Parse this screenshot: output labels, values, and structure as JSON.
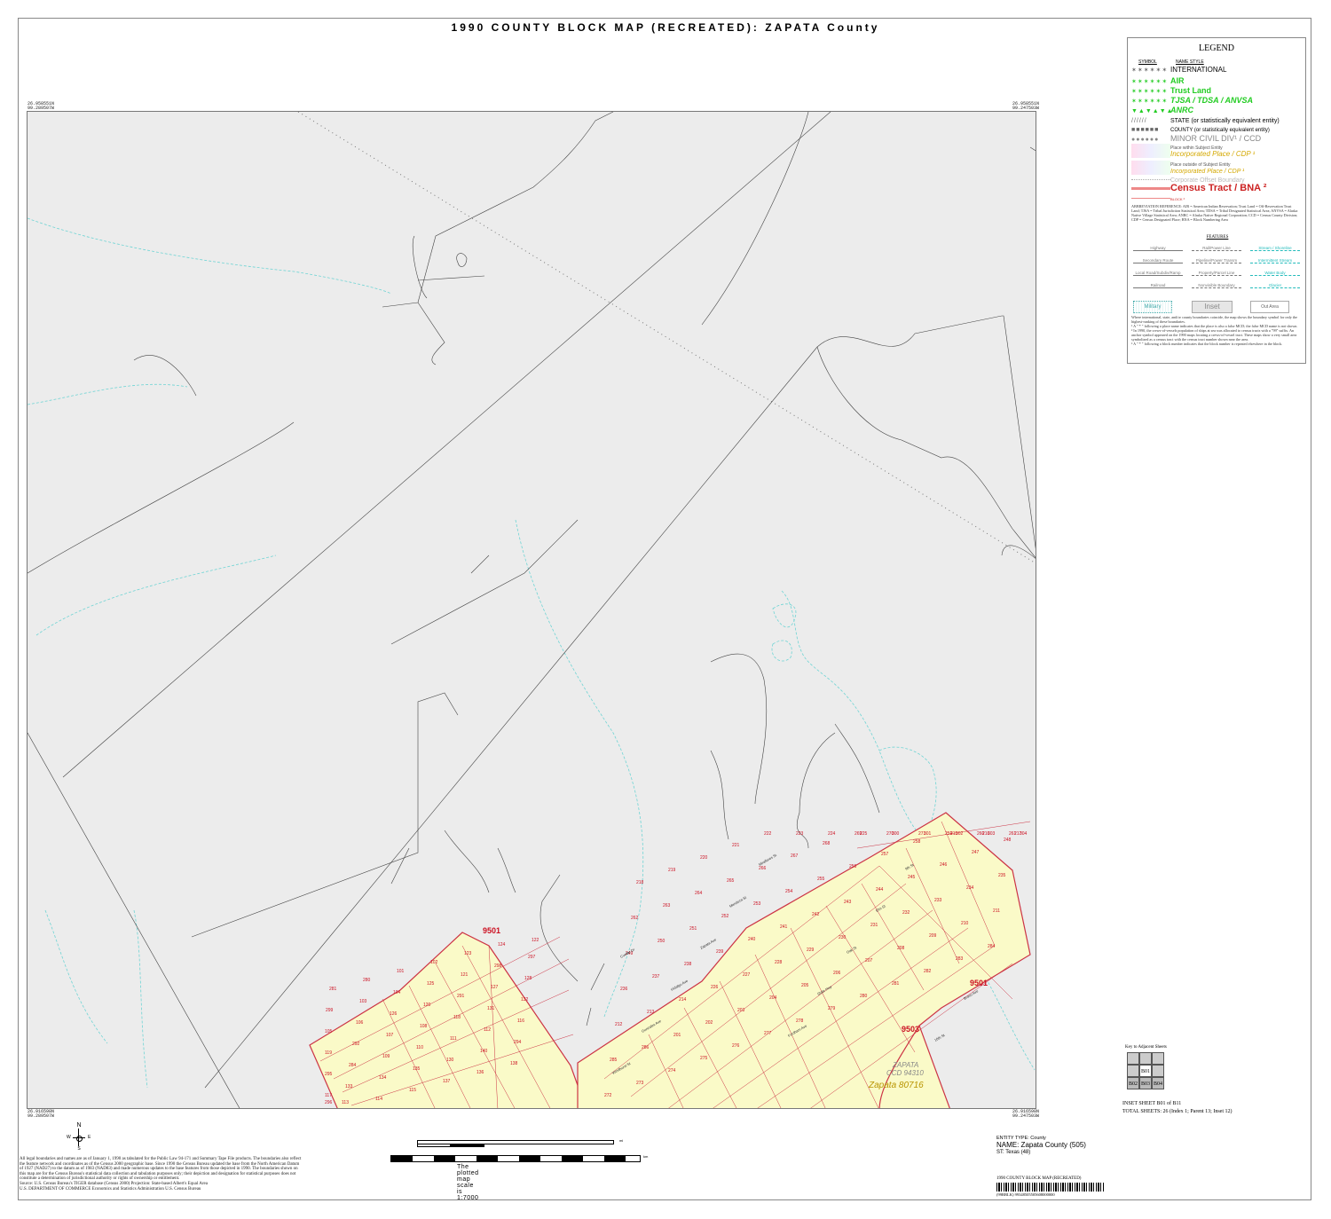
{
  "title": "1990 COUNTY BLOCK MAP (RECREATED): ZAPATA County",
  "corners": {
    "top_left": [
      "26.958551N",
      "99.289507W"
    ],
    "top_right": [
      "26.958551N",
      "99.247503W"
    ],
    "bottom_left": [
      "26.916598N",
      "99.289507W"
    ],
    "bottom_right": [
      "26.916598N",
      "99.247503W"
    ]
  },
  "legend": {
    "title": "LEGEND",
    "symbol_header": "SYMBOL",
    "name_header": "NAME STYLE",
    "items": [
      {
        "symbol": "✶✶✶✶✶✶",
        "label": "INTERNATIONAL",
        "color": "#000000"
      },
      {
        "symbol": "✶✶✶✶✶✶",
        "label": "AIR",
        "color": "#22cc22"
      },
      {
        "symbol": "✶✶✶✶✶✶",
        "label": "Trust Land",
        "color": "#22cc22"
      },
      {
        "symbol": "✶✶✶✶✶✶",
        "label": "TJSA / TDSA / ANVSA",
        "color": "#22cc22"
      },
      {
        "symbol": "▼▲▼▲▼▲",
        "label": "ANRC",
        "color": "#22cc22"
      },
      {
        "symbol": "//////",
        "label": "STATE (or statistically equivalent entity)",
        "color": "#000000"
      },
      {
        "symbol": "■■■■■■",
        "label": "COUNTY (or statistically equivalent entity)",
        "color": "#000000"
      },
      {
        "symbol": "●●●●●●",
        "label": "MINOR CIVIL DIV¹ / CCD",
        "color": "#888888"
      },
      {
        "symbol": "",
        "label": "Place within Subject Entity",
        "color": "#555555"
      },
      {
        "symbol": "",
        "label": "Incorporated Place / CDP ¹",
        "color": "#d4a800"
      },
      {
        "symbol": "",
        "label": "Place outside of Subject Entity",
        "color": "#555555"
      },
      {
        "symbol": "",
        "label": "Incorporated Place / CDP ¹",
        "color": "#d4a800"
      },
      {
        "symbol": "",
        "label": "Corporate Offset Boundary",
        "color": "#bbbbbb"
      },
      {
        "symbol": "",
        "label": "Census Tract / BNA ²",
        "color": "#cc2222"
      },
      {
        "symbol": "",
        "label": "BLOCK ³",
        "color": "#cc2222"
      }
    ],
    "abbreviation_reference": "ABBREVIATION REFERENCE: AIR = American Indian Reservation; Trust Land = Off-Reservation Trust Land; TJSA = Tribal Jurisdiction Statistical Area; TDSA = Tribal Designated Statistical Area; ANVSA = Alaska Native Village Statistical Area; ANRC = Alaska Native Regional Corporation; CCD = Census County Division; CDP = Census Designated Place; BNA = Block Numbering Area",
    "features_title": "FEATURES",
    "features": [
      "Highway",
      "Rail/Power Line",
      "Stream / Shoreline",
      "Secondary Route",
      "Pipeline/Power Transm",
      "Intermittent Stream",
      "Local Road/Subdiv/Ramp",
      "Property/Parcel Line",
      "Water Body",
      "Railroad",
      "Nonvisible Boundary",
      "Glacier"
    ],
    "box_labels": [
      "Military",
      "Inset",
      "Out Area"
    ],
    "notes": [
      "Where international, state, and/or county boundaries coincide, the map shows the boundary symbol for only the highest-ranking of these boundaries.",
      "¹ A \" * \" following a place name indicates that the place is also a false MCD; the false MCD name is not shown.",
      "² In 1990, the crews-of-vessels population of ships at sea was allocated to census tracts with a \"99\" suffix. An anchor symbol appeared on the 1990 maps locating a crews-of-vessel tract. These maps show a very small area symbolized as a census tract with the census tract number shown near the area.",
      "³ A \" * \" following a block number indicates that the block number is repeated elsewhere in the block."
    ]
  },
  "key_sheets": {
    "title": "Key to Adjacent Sheets",
    "cells": [
      "B01",
      "B02",
      "B03",
      "B04"
    ]
  },
  "sheet_info": {
    "inset": "INSET SHEET B01 of B11",
    "total": "TOTAL SHEETS: 26 (Index 1; Parent 13; Inset 12)"
  },
  "entity": {
    "type": "ENTITY TYPE: County",
    "name": "NAME: Zapata County (505)",
    "state": "ST: Texas (48)"
  },
  "scale_text": "The plotted map scale is 1:7000",
  "scale_mi": "mi",
  "scale_km": "km",
  "scale_ticks_top": [
    "0",
    "1",
    "2",
    "3",
    "4"
  ],
  "barcode_title": "1990 COUNTY BLOCK MAP (RECREATED)",
  "barcode_id": "(99RBLK) 99348505505608000000",
  "compass": {
    "n": "N",
    "s": "S",
    "e": "E",
    "w": "W"
  },
  "footnote": "All legal boundaries and names are as of January 1, 1990 as tabulated for the Public Law 94-171 and Summary Tape File products. The boundaries also reflect the feature network and coordinates as of the Census 2000 geographic base. Since 1990 the Census Bureau updated the base from the North American Datum of 1927 (NAD27) to the datum as of 1983 (NAD83) and made numerous updates to the base features from those depicted in 1990. The boundaries shown on this map are for the Census Bureau's statistical data collection and tabulation purposes only; their depiction and designation for statistical purposes does not constitute a determination of jurisdictional authority or rights of ownership or entitlement.",
  "source": "Source: U.S. Census Bureau's TIGER database (Census 2000)       Projection: State-based Albert's Equal Area",
  "agency": "U.S. DEPARTMENT OF COMMERCE Economics and Statistics Administration  U.S. Census Bureau",
  "map_labels": {
    "tract_9501_a": "9501",
    "tract_9501_b": "9501",
    "tract_9503": "9503",
    "ccd_name": "ZAPATA",
    "ccd_code": "CCD 94310",
    "place": "Zapata 80716"
  },
  "blocks_left": [
    "281",
    "280",
    "101",
    "102",
    "123",
    "124",
    "122",
    "299",
    "103",
    "104",
    "125",
    "121",
    "298",
    "297",
    "105",
    "106",
    "126",
    "120",
    "291",
    "127",
    "128",
    "119",
    "292",
    "107",
    "108",
    "118",
    "131",
    "132",
    "295",
    "284",
    "109",
    "110",
    "111",
    "112",
    "116",
    "117",
    "133",
    "134",
    "135",
    "130",
    "140",
    "294",
    "296",
    "113",
    "114",
    "115",
    "137",
    "136",
    "138"
  ],
  "blocks_right": [
    "272",
    "273",
    "274",
    "275",
    "276",
    "277",
    "278",
    "279",
    "280",
    "281",
    "282",
    "283",
    "284",
    "285",
    "286",
    "201",
    "202",
    "203",
    "204",
    "205",
    "206",
    "207",
    "208",
    "209",
    "210",
    "211",
    "212",
    "213",
    "214",
    "226",
    "227",
    "228",
    "229",
    "230",
    "231",
    "232",
    "233",
    "234",
    "235",
    "236",
    "237",
    "238",
    "239",
    "240",
    "241",
    "242",
    "243",
    "244",
    "245",
    "246",
    "247",
    "248",
    "249",
    "250",
    "251",
    "252",
    "253",
    "254",
    "255",
    "256",
    "257",
    "258",
    "259",
    "260",
    "261",
    "262",
    "263",
    "264",
    "265",
    "266",
    "267",
    "268",
    "269",
    "270",
    "271",
    "215",
    "216",
    "217",
    "218",
    "219",
    "220",
    "221",
    "222",
    "223",
    "224",
    "225",
    "300",
    "301",
    "302",
    "303",
    "304"
  ],
  "streets": [
    "Windhurst St",
    "Gonzales Ave",
    "Hidalgo Ave",
    "Zapata Ave",
    "Mendoza St",
    "Miraflores St",
    "Fordham Ave",
    "State Hwy",
    "Oak St",
    "Elm St",
    "9th St",
    "10th St",
    "Bravo Ave",
    "Cuellar Dr"
  ]
}
